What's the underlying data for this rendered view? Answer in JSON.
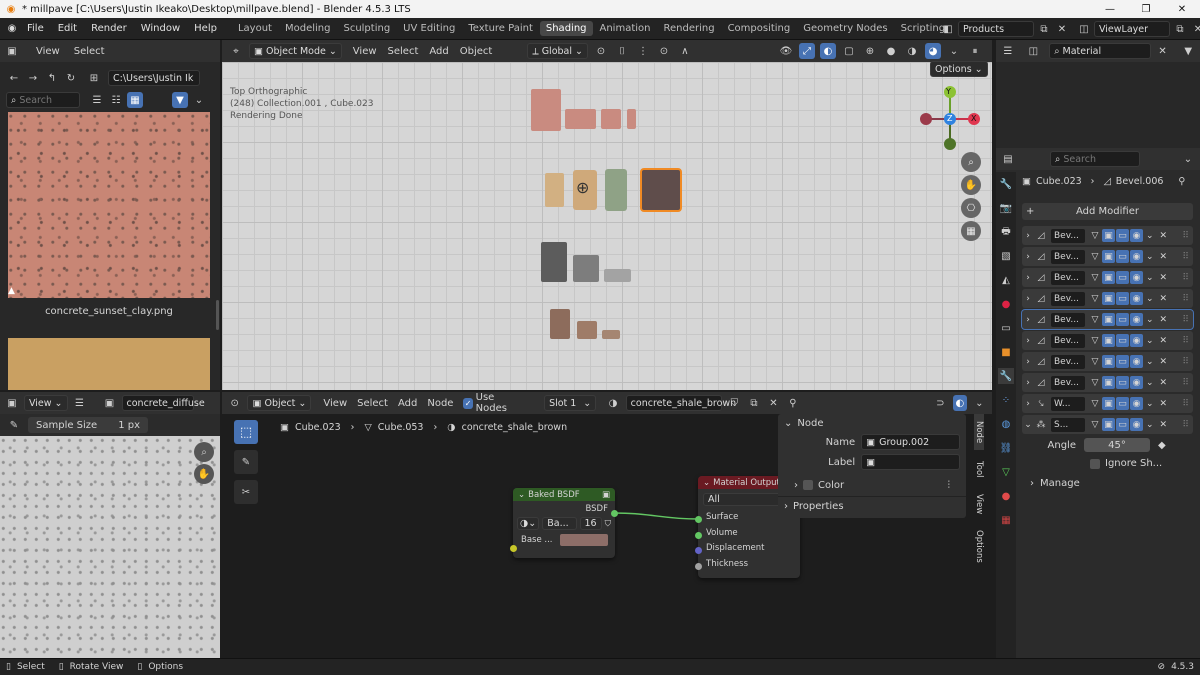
{
  "window": {
    "title": "* millpave [C:\\Users\\Justin Ikeako\\Desktop\\millpave.blend] - Blender 4.5.3 LTS"
  },
  "menu": [
    "File",
    "Edit",
    "Render",
    "Window",
    "Help"
  ],
  "workspaces": [
    "Layout",
    "Modeling",
    "Sculpting",
    "UV Editing",
    "Texture Paint",
    "Shading",
    "Animation",
    "Rendering",
    "Compositing",
    "Geometry Nodes",
    "Scripting"
  ],
  "active_workspace": "Shading",
  "scene": "Products",
  "view_layer": "ViewLayer",
  "file_browser": {
    "menu": [
      "View",
      "Select"
    ],
    "path": "C:\\Users\\Justin Ik",
    "search_placeholder": "Search",
    "image1_label": "concrete_sunset_clay.png"
  },
  "image_editor": {
    "view": "View",
    "image_name": "concrete_diffuse",
    "sample_size_label": "Sample Size",
    "sample_size_value": "1 px"
  },
  "viewport": {
    "mode": "Object Mode",
    "menu": [
      "View",
      "Select",
      "Add",
      "Object"
    ],
    "transform": "Global",
    "options": "Options",
    "info_line1": "Top Orthographic",
    "info_line2": "(248) Collection.001 , Cube.023",
    "info_line3": "Rendering Done",
    "gizmo": {
      "x": "X",
      "y": "Y",
      "z": "Z"
    }
  },
  "node_editor": {
    "type": "Object",
    "menu": [
      "View",
      "Select",
      "Add",
      "Node"
    ],
    "use_nodes": "Use Nodes",
    "slot": "Slot 1",
    "material": "concrete_shale_brown",
    "breadcrumb": [
      "Cube.023",
      "Cube.053",
      "concrete_shale_brown"
    ],
    "baked_node": {
      "title": "Baked BSDF",
      "output": "BSDF",
      "image": "Ba...",
      "num": "16",
      "input": "Base ..."
    },
    "output_node": {
      "title": "Material Output",
      "target": "All",
      "inputs": [
        "Surface",
        "Volume",
        "Displacement",
        "Thickness"
      ]
    },
    "sidebar": {
      "node_header": "Node",
      "name_label": "Name",
      "name_value": "Group.002",
      "label_label": "Label",
      "label_value": "",
      "color": "Color",
      "properties": "Properties"
    },
    "tabs": [
      "Node",
      "Tool",
      "View",
      "Options"
    ]
  },
  "outliner": {
    "search_placeholder": "Material"
  },
  "properties": {
    "search_placeholder": "Search",
    "object": "Cube.023",
    "modifier_path": "Bevel.006",
    "add_modifier": "Add Modifier",
    "modifiers": [
      "Bev...",
      "Bev...",
      "Bev...",
      "Bev...",
      "Bev...",
      "Bev...",
      "Bev...",
      "Bev...",
      "W...",
      "S..."
    ],
    "angle_label": "Angle",
    "angle_value": "45°",
    "ignore_label": "Ignore Sh...",
    "manage": "Manage"
  },
  "status": {
    "select": "Select",
    "rotate": "Rotate View",
    "options": "Options",
    "version": "4.5.3"
  },
  "colors": {
    "accent": "#4772b3",
    "header": "#303030",
    "select_orange": "#f08a24",
    "clay": "#c98b78",
    "shader_header": "#2e5a24",
    "output_header": "#6a1a22",
    "socket_green": "#63c763",
    "socket_yellow": "#c7c729",
    "socket_purple": "#6363c7",
    "socket_grey": "#a1a1a1"
  }
}
